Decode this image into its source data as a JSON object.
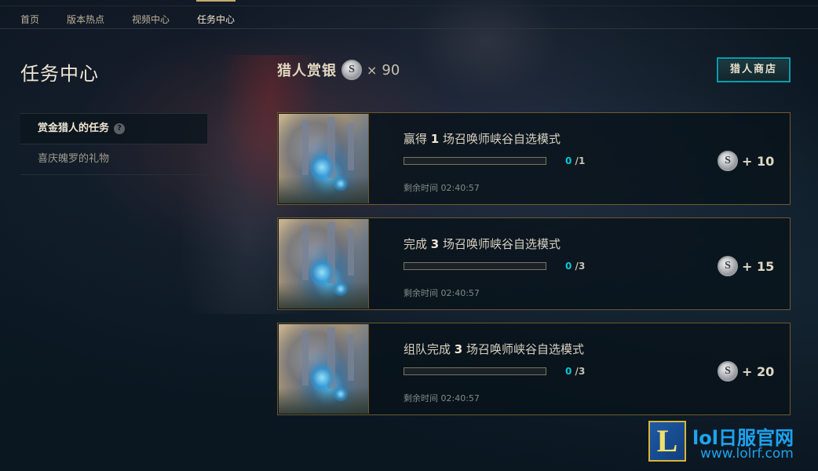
{
  "nav": {
    "items": [
      {
        "label": "首页"
      },
      {
        "label": "版本热点"
      },
      {
        "label": "视频中心"
      },
      {
        "label": "任务中心"
      }
    ],
    "active_index": 3
  },
  "page_title": "任务中心",
  "sidebar": {
    "items": [
      {
        "label": "赏金猎人的任务",
        "active": true,
        "help_icon": "?"
      },
      {
        "label": "喜庆魄罗的礼物",
        "active": false
      }
    ]
  },
  "currency": {
    "label": "猎人赏银",
    "coin_icon": "S",
    "times": "×",
    "amount": "90"
  },
  "shop_button": {
    "label": "猎人商店"
  },
  "missions": [
    {
      "title_pre": "赢得 ",
      "title_num": "1",
      "title_post": " 场召唤师峡谷自选模式",
      "progress_current": "0",
      "progress_sep": "/",
      "progress_total": "1",
      "progress_fraction": 0,
      "timer": "剩余时间 02:40:57",
      "reward": "+ 10"
    },
    {
      "title_pre": "完成 ",
      "title_num": "3",
      "title_post": " 场召唤师峡谷自选模式",
      "progress_current": "0",
      "progress_sep": "/",
      "progress_total": "3",
      "progress_fraction": 0,
      "timer": "剩余时间 02:40:57",
      "reward": "+ 15"
    },
    {
      "title_pre": "组队完成 ",
      "title_num": "3",
      "title_post": " 场召唤师峡谷自选模式",
      "progress_current": "0",
      "progress_sep": "/",
      "progress_total": "3",
      "progress_fraction": 0,
      "timer": "剩余时间 02:40:57",
      "reward": "+ 20"
    }
  ],
  "watermark": {
    "logo_letter": "L",
    "title": "lol日服官网",
    "url": "www.lolrf.com"
  },
  "colors": {
    "accent_gold": "#c8aa6e",
    "accent_teal": "#0ac8d8",
    "shop_border": "#0a9cae",
    "watermark_blue": "#1da3f0"
  }
}
